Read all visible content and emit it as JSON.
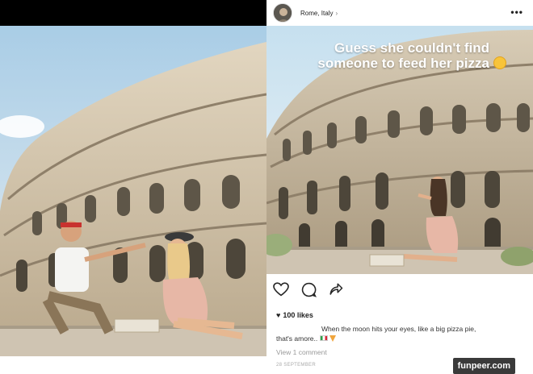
{
  "left": {
    "photo_alt": ""
  },
  "post": {
    "location": "Rome, Italy",
    "chevron": "›",
    "more": "•••",
    "overlay_text": "Guess she couldn't find someone to feed her pizza",
    "likes": "100 likes",
    "caption_line1": "When the moon hits your eyes, like a big pizza pie,",
    "caption_line2": "that's amore..",
    "view_comments": "View 1 comment",
    "date": "28 SEPTEMBER"
  },
  "icons": {
    "heart": "heart-icon",
    "comment": "comment-icon",
    "share": "share-icon"
  },
  "watermark": "funpeer.com",
  "colors": {
    "sky": "#bcd8ea",
    "stone": "#d9c9ad",
    "stone_shadow": "#8a7c68",
    "watermark_bg": "#3a3a3a"
  }
}
